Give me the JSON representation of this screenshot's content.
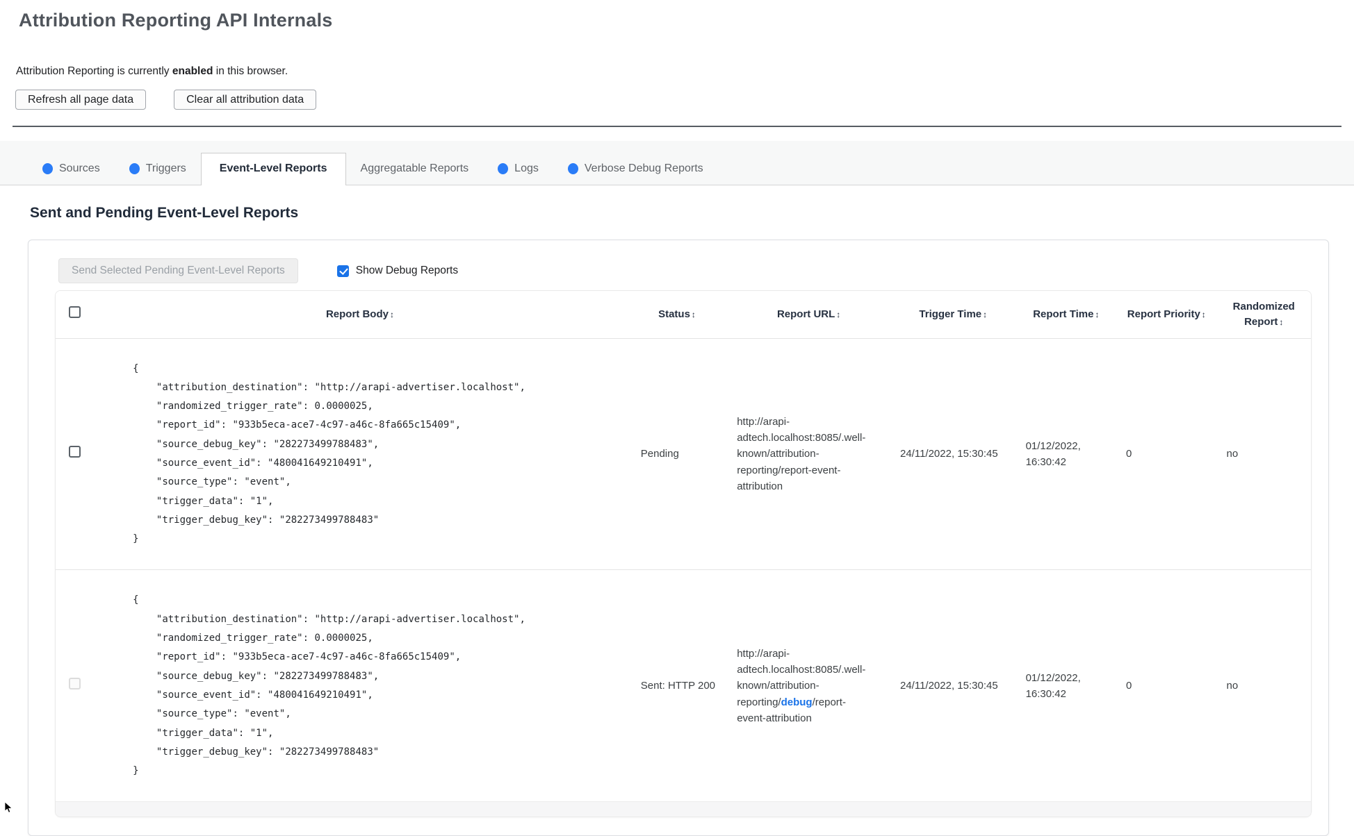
{
  "page": {
    "title": "Attribution Reporting API Internals",
    "status_prefix": "Attribution Reporting is currently ",
    "status_emphasis": "enabled",
    "status_suffix": " in this browser.",
    "refresh_button": "Refresh all page data",
    "clear_button": "Clear all attribution data"
  },
  "tabs": [
    {
      "label": "Sources",
      "dot": true,
      "active": false
    },
    {
      "label": "Triggers",
      "dot": true,
      "active": false
    },
    {
      "label": "Event-Level Reports",
      "dot": false,
      "active": true
    },
    {
      "label": "Aggregatable Reports",
      "dot": false,
      "active": false
    },
    {
      "label": "Logs",
      "dot": true,
      "active": false
    },
    {
      "label": "Verbose Debug Reports",
      "dot": true,
      "active": false
    }
  ],
  "panel": {
    "heading": "Sent and Pending Event-Level Reports",
    "send_button": "Send Selected Pending Event-Level Reports",
    "send_button_enabled": false,
    "show_debug_label": "Show Debug Reports",
    "show_debug_checked": true
  },
  "table": {
    "sort_icon": "↕",
    "columns": [
      {
        "label": "",
        "name": "select",
        "sortable": false
      },
      {
        "label": "Report Body",
        "name": "report-body",
        "sortable": true
      },
      {
        "label": "Status",
        "name": "status",
        "sortable": true
      },
      {
        "label": "Report URL",
        "name": "report-url",
        "sortable": true
      },
      {
        "label": "Trigger Time",
        "name": "trigger-time",
        "sortable": true
      },
      {
        "label": "Report Time",
        "name": "report-time",
        "sortable": true
      },
      {
        "label": "Report Priority",
        "name": "report-priority",
        "sortable": true
      },
      {
        "label": "Randomized Report",
        "name": "randomized-report",
        "sortable": true
      }
    ],
    "col_widths": [
      "3%",
      "42.5%",
      "8%",
      "13%",
      "10%",
      "8%",
      "8%",
      "7.5%"
    ],
    "rows": [
      {
        "checkbox_enabled": true,
        "checkbox_checked": false,
        "report_body": "{\n    \"attribution_destination\": \"http://arapi-advertiser.localhost\",\n    \"randomized_trigger_rate\": 0.0000025,\n    \"report_id\": \"933b5eca-ace7-4c97-a46c-8fa665c15409\",\n    \"source_debug_key\": \"282273499788483\",\n    \"source_event_id\": \"480041649210491\",\n    \"source_type\": \"event\",\n    \"trigger_data\": \"1\",\n    \"trigger_debug_key\": \"282273499788483\"\n}",
        "status": "Pending",
        "url_parts": [
          {
            "text": "http://arapi-adtech.localhost:8085/.well-known/attribution-reporting/report-event-attribution",
            "link": false
          }
        ],
        "trigger_time": "24/11/2022, 15:30:45",
        "report_time": "01/12/2022, 16:30:42",
        "report_priority": "0",
        "randomized_report": "no"
      },
      {
        "checkbox_enabled": false,
        "checkbox_checked": false,
        "report_body": "{\n    \"attribution_destination\": \"http://arapi-advertiser.localhost\",\n    \"randomized_trigger_rate\": 0.0000025,\n    \"report_id\": \"933b5eca-ace7-4c97-a46c-8fa665c15409\",\n    \"source_debug_key\": \"282273499788483\",\n    \"source_event_id\": \"480041649210491\",\n    \"source_type\": \"event\",\n    \"trigger_data\": \"1\",\n    \"trigger_debug_key\": \"282273499788483\"\n}",
        "status": "Sent: HTTP 200",
        "url_parts": [
          {
            "text": "http://arapi-adtech.localhost:8085/.well-known/attribution-reporting/",
            "link": false
          },
          {
            "text": "debug",
            "link": true
          },
          {
            "text": "/report-event-attribution",
            "link": false
          }
        ],
        "trigger_time": "24/11/2022, 15:30:45",
        "report_time": "01/12/2022, 16:30:42",
        "report_priority": "0",
        "randomized_report": "no"
      }
    ]
  },
  "colors": {
    "tab_dot_blue": "#2a7cf7",
    "debug_link_blue": "#1a73e8",
    "checkbox_blue": "#1a73e8",
    "header_navy": "#273141"
  }
}
